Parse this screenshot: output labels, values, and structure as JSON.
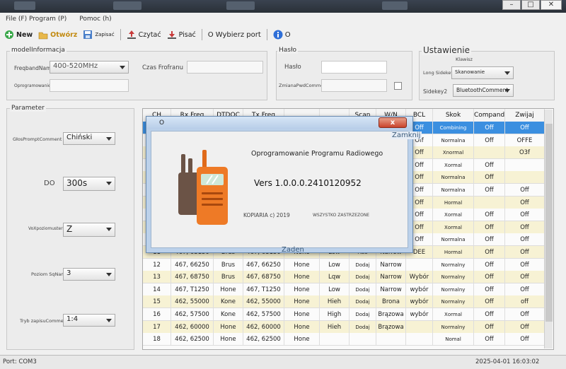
{
  "menu": {
    "file": "File (F) Program (P)",
    "help": "Pomoc (h)"
  },
  "toolbar": {
    "new": "New",
    "open": "Otwórz",
    "save": "Zapisać",
    "read": "Czytać",
    "write": "Pisać",
    "port": "O Wybierz port",
    "about": "O"
  },
  "model_group": {
    "title": "modelInformacja",
    "freqband_label": "FreqbandName",
    "freqband_value": "400-520MHz",
    "time_label": "Czas Frofranu",
    "firmware_label": "OprogramowanieFirmwa"
  },
  "password_group": {
    "title": "Hasło",
    "password_label": "Hasło",
    "change_label": "ZmianaPwdComment"
  },
  "settings_group": {
    "title": "Ustawienie",
    "key_label": "Klawisz",
    "sidekey1_label": "Long Sidekey1 ",
    "sidekey1_value": "Skanowanie",
    "sidekey2_label": "Sidekey2 ",
    "sidekey2_value": "BluetoothComment"
  },
  "param_group": {
    "title": "Parameter",
    "prompt_label": "GłosPromptComment",
    "prompt_value": "Chiński",
    "do_label": "DO",
    "do_value": "300s",
    "vox_label": "VoXpoziomusterdrive",
    "vox_value": "Z",
    "squelch_label": "Poziom SqName",
    "squelch_value": "3",
    "save_label": "Tryb zapisuComment",
    "save_value": "1:4"
  },
  "table": {
    "headers": [
      "CH",
      "Rx Freq",
      "DTDOC",
      "Tx Freq",
      "",
      "",
      "Scan",
      "W/N",
      "BCL",
      "Skok",
      "Compand",
      "Zwijaj"
    ],
    "top_rows": [
      [
        "",
        "",
        "",
        "",
        "",
        "",
        "",
        "",
        "Off",
        "Combining",
        "Off",
        "Off"
      ],
      [
        "",
        "",
        "",
        "",
        "",
        "",
        "",
        "",
        "Off",
        "Normalna",
        "Off",
        "OFFE"
      ],
      [
        "",
        "",
        "",
        "",
        "",
        "",
        "",
        "",
        "Off",
        "Xnormal",
        "",
        "O3f"
      ],
      [
        "",
        "",
        "",
        "",
        "",
        "",
        "",
        "",
        "Off",
        "Xormal",
        "Off",
        ""
      ],
      [
        "",
        "",
        "",
        "",
        "",
        "",
        "",
        "",
        "Off",
        "Normalna",
        "Off",
        ""
      ],
      [
        "",
        "",
        "",
        "",
        "",
        "",
        "",
        "",
        "Off",
        "Normalna",
        "Off",
        "Off"
      ],
      [
        "",
        "",
        "",
        "",
        "",
        "",
        "",
        "",
        "Off",
        "Hormal",
        "",
        "Off"
      ],
      [
        "",
        "",
        "",
        "",
        "",
        "",
        "",
        "",
        "Off",
        "Xormal",
        "Off",
        "Off"
      ],
      [
        "",
        "",
        "",
        "",
        "",
        "",
        "",
        "",
        "Off",
        "Xormal",
        "Off",
        "Off"
      ],
      [
        "",
        "",
        "",
        "",
        "",
        "",
        "",
        "",
        "Off",
        "Normalna",
        "Off",
        "Off"
      ]
    ],
    "rows": [
      [
        "11",
        "467, 63150",
        "Brus",
        "467, 63150",
        "None",
        "Low",
        "Add",
        "Narrow",
        "DEE",
        "Hormal",
        "Off",
        "Off"
      ],
      [
        "12",
        "467, 66250",
        "Brus",
        "467, 66250",
        "Hone",
        "Low",
        "Dodaj",
        "Narrow",
        "",
        "Normalny",
        "Off",
        "Off"
      ],
      [
        "13",
        "467, 68750",
        "Brus",
        "467, 68750",
        "Hone",
        "Lqw",
        "Dodaj",
        "Narrow",
        "Wybór",
        "Normalny",
        "Off",
        "Off"
      ],
      [
        "14",
        "467, T1250",
        "Hone",
        "467, T1250",
        "Hone",
        "Low",
        "Dodaj",
        "Narrow",
        "wybór",
        "Normalny",
        "Off",
        "Off"
      ],
      [
        "15",
        "462, 55000",
        "Kone",
        "462, 55000",
        "Hone",
        "Hieh",
        "Dodaj",
        "Brona",
        "wybór",
        "Normalny",
        "Off",
        "off"
      ],
      [
        "16",
        "462, 57500",
        "Kone",
        "462, 57500",
        "Hone",
        "High",
        "Dodaj",
        "Brązowa",
        "wybór",
        "Xormal",
        "Off",
        "Off"
      ],
      [
        "17",
        "462, 60000",
        "Hone",
        "462, 60000",
        "Hone",
        "Hieh",
        "Dodaj",
        "Brązowa",
        "",
        "Normalny",
        "Off",
        "Off"
      ],
      [
        "18",
        "462, 62500",
        "Hone",
        "462, 62500",
        "Hone",
        "",
        "",
        "",
        "",
        "Nomal",
        "Off",
        "Off"
      ]
    ]
  },
  "dialog": {
    "title": "O",
    "close": "x",
    "close_tooltip": "Zamknij",
    "product": "Oprogramowanie Programu Radiowego",
    "version": "Vers 1.0.0.0.2410120952",
    "copyright": "KOPIARIA c) 2019",
    "rights": "WSZYSTKO ZASTRZEZONE",
    "footer_hint": "Zaden"
  },
  "status": {
    "port": "Port: COM3",
    "datetime": "2025-04-01 16:03:02"
  },
  "colors": {
    "selected_row": "#3b8fe0",
    "alt_row": "#f7f2d4",
    "accent": "#2f6fd8"
  }
}
